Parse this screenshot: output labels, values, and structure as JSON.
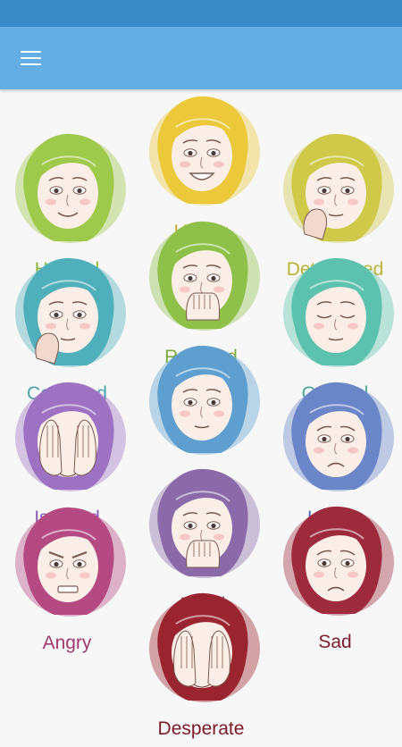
{
  "status_bar": {
    "color": "#3a8ac8"
  },
  "app_bar": {
    "color": "#64ade5",
    "menu_icon": "hamburger-menu-icon"
  },
  "emotions": [
    {
      "label": "Happy",
      "color": "#c7a726",
      "hair": "#ebc93a",
      "expression": "smile-open"
    },
    {
      "label": "Hopeful",
      "color": "#8cb93a",
      "hair": "#9ec94a",
      "expression": "smile"
    },
    {
      "label": "Determined",
      "color": "#b9b338",
      "hair": "#cfc94a",
      "expression": "hand-chin"
    },
    {
      "label": "Relieved",
      "color": "#7daa3c",
      "hair": "#8fc04a",
      "expression": "hand-mouth"
    },
    {
      "label": "Confused",
      "color": "#4aa3ad",
      "hair": "#4fb0bb",
      "expression": "hand-chin"
    },
    {
      "label": "Grateful",
      "color": "#4aa591",
      "hair": "#5cc2ad",
      "expression": "eyes-closed"
    },
    {
      "label": "Okay",
      "color": "#4a87b8",
      "hair": "#5e9fd0",
      "expression": "neutral"
    },
    {
      "label": "Isolated",
      "color": "#8a5caf",
      "hair": "#9e72c2",
      "expression": "hands-face"
    },
    {
      "label": "Lonely",
      "color": "#4e6eae",
      "hair": "#6a85c8",
      "expression": "sad"
    },
    {
      "label": "Afraid",
      "color": "#71508e",
      "hair": "#8a6aa8",
      "expression": "hand-mouth"
    },
    {
      "label": "Angry",
      "color": "#a03a6e",
      "hair": "#b54a82",
      "expression": "angry"
    },
    {
      "label": "Sad",
      "color": "#7a1c2e",
      "hair": "#9e2a3e",
      "expression": "sad"
    },
    {
      "label": "Desperate",
      "color": "#7a1a26",
      "hair": "#9a2430",
      "expression": "hands-face"
    }
  ]
}
